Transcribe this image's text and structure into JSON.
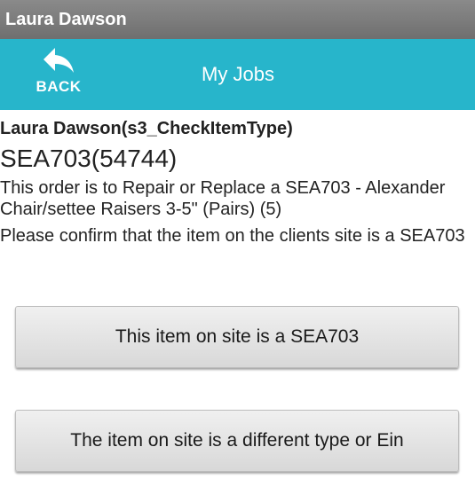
{
  "app": {
    "window_title": "Laura Dawson"
  },
  "navbar": {
    "back_label": "BACK",
    "back_icon": "reply-arrow-icon",
    "title": "My Jobs",
    "bg_color": "#27b5cb"
  },
  "job": {
    "customer_line": "Laura Dawson(s3_CheckItemType)",
    "code_line": "SEA703(54744)",
    "description": "This order is to Repair or Replace a  SEA703 - Alexander Chair/settee Raisers 3-5\" (Pairs) (5)",
    "confirm_prompt": "Please confirm that the item on the clients site is a SEA703"
  },
  "actions": {
    "confirm_button": "This item on site is a SEA703",
    "different_button": "The item on site is a different type or Ein"
  }
}
